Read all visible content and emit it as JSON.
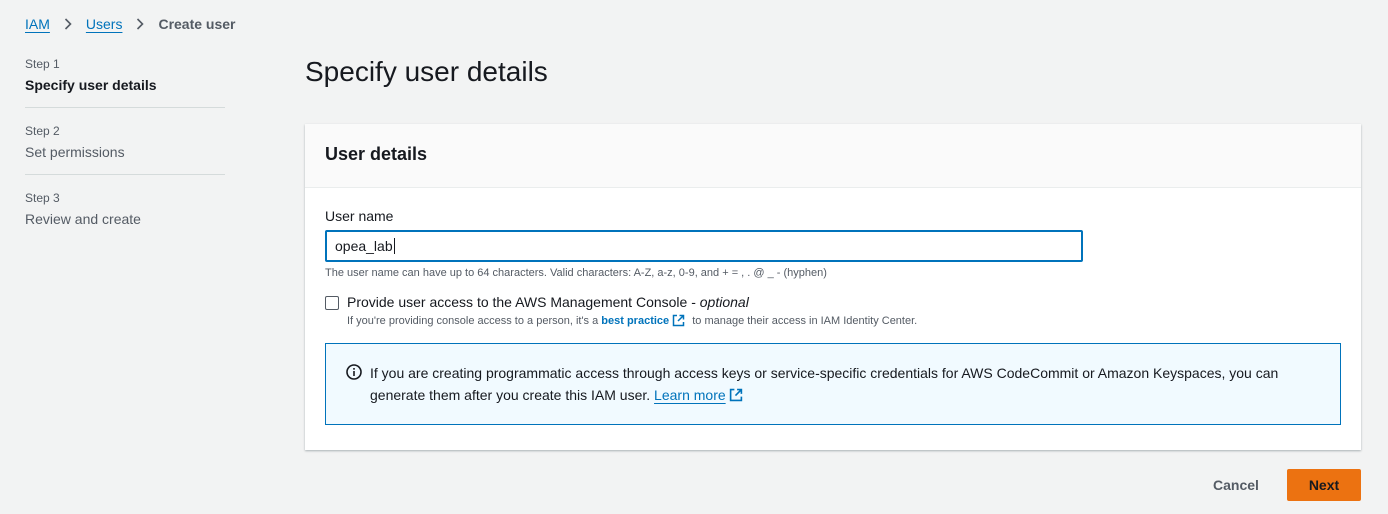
{
  "breadcrumb": {
    "items": [
      "IAM",
      "Users"
    ],
    "current": "Create user"
  },
  "steps": [
    {
      "number": "Step 1",
      "title": "Specify user details",
      "active": true
    },
    {
      "number": "Step 2",
      "title": "Set permissions",
      "active": false
    },
    {
      "number": "Step 3",
      "title": "Review and create",
      "active": false
    }
  ],
  "page": {
    "title": "Specify user details"
  },
  "panel": {
    "header": "User details",
    "username_label": "User name",
    "username_value": "opea_lab",
    "username_hint": "The user name can have up to 64 characters. Valid characters: A-Z, a-z, 0-9, and + = , . @ _ - (hyphen)",
    "console_label": "Provide user access to the AWS Management Console - ",
    "console_optional": "optional",
    "console_checked": false,
    "console_desc_prefix": "If you're providing console access to a person, it's a ",
    "console_desc_link": "best practice",
    "console_desc_suffix": " to manage their access in IAM Identity Center.",
    "info_text": "If you are creating programmatic access through access keys or service-specific credentials for AWS CodeCommit or Amazon Keyspaces, you can generate them after you create this IAM user. ",
    "info_link": "Learn more"
  },
  "footer": {
    "cancel_label": "Cancel",
    "next_label": "Next"
  },
  "colors": {
    "accent": "#0073bb",
    "primary_button": "#ec7211",
    "background": "#f2f3f3"
  },
  "icons": {
    "breadcrumb_separator": "chevron-right-icon",
    "external_link": "external-link-icon",
    "info": "info-circle-icon"
  }
}
